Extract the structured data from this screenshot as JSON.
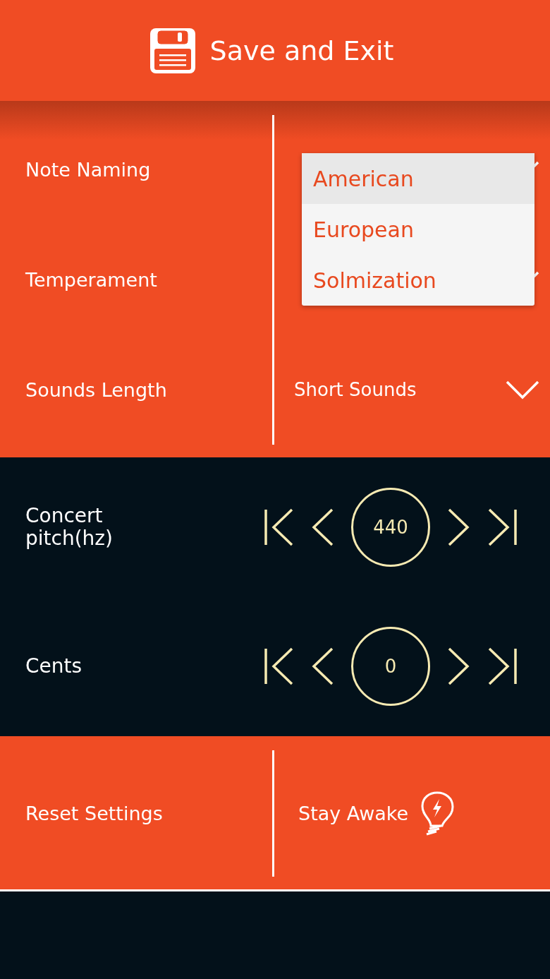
{
  "header": {
    "title": "Save and Exit"
  },
  "settings": [
    {
      "label": "Note Naming"
    },
    {
      "label": "Temperament"
    },
    {
      "label": "Sounds Length",
      "value": "Short Sounds"
    }
  ],
  "dropdown": {
    "options": [
      {
        "label": "American",
        "selected": true
      },
      {
        "label": "European",
        "selected": false
      },
      {
        "label": "Solmization",
        "selected": false
      }
    ]
  },
  "steppers": [
    {
      "label": "Concert pitch(hz)",
      "value": "440"
    },
    {
      "label": "Cents",
      "value": "0"
    }
  ],
  "actions": [
    {
      "label": "Reset Settings",
      "kind": "reset"
    },
    {
      "label": "Stay Awake",
      "kind": "awake"
    }
  ]
}
